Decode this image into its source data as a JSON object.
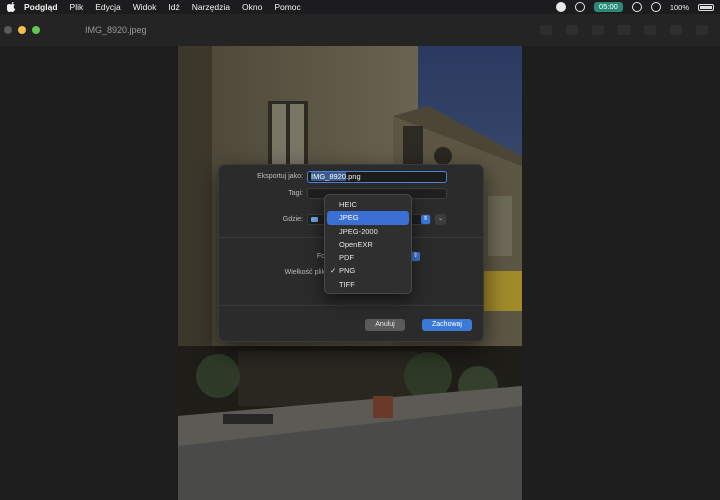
{
  "menubar": {
    "app": "Podgląd",
    "items": [
      "Plik",
      "Edycja",
      "Widok",
      "Idź",
      "Narzędzia",
      "Okno",
      "Pomoc"
    ],
    "time_badge": "05:00",
    "battery": "100%"
  },
  "window": {
    "title": "IMG_8920.jpeg"
  },
  "dialog": {
    "export_label": "Eksportuj jako:",
    "filename_selected": "IMG_8920",
    "filename_ext": ".png",
    "tags_label": "Tagi:",
    "where_label": "Gdzie:",
    "format_label": "Format",
    "filesize_label": "Wielkość pliku",
    "cancel": "Anuluj",
    "save": "Zachowaj"
  },
  "format_menu": {
    "items": [
      {
        "label": "HEIC",
        "active": false,
        "checked": false
      },
      {
        "label": "JPEG",
        "active": true,
        "checked": false
      },
      {
        "label": "JPEG-2000",
        "active": false,
        "checked": false
      },
      {
        "label": "OpenEXR",
        "active": false,
        "checked": false
      },
      {
        "label": "PDF",
        "active": false,
        "checked": false
      },
      {
        "label": "PNG",
        "active": false,
        "checked": true
      },
      {
        "label": "TIFF",
        "active": false,
        "checked": false
      }
    ],
    "check_glyph": "✓"
  },
  "colors": {
    "accent": "#3b6fd4",
    "save_button": "#3b79d8"
  }
}
